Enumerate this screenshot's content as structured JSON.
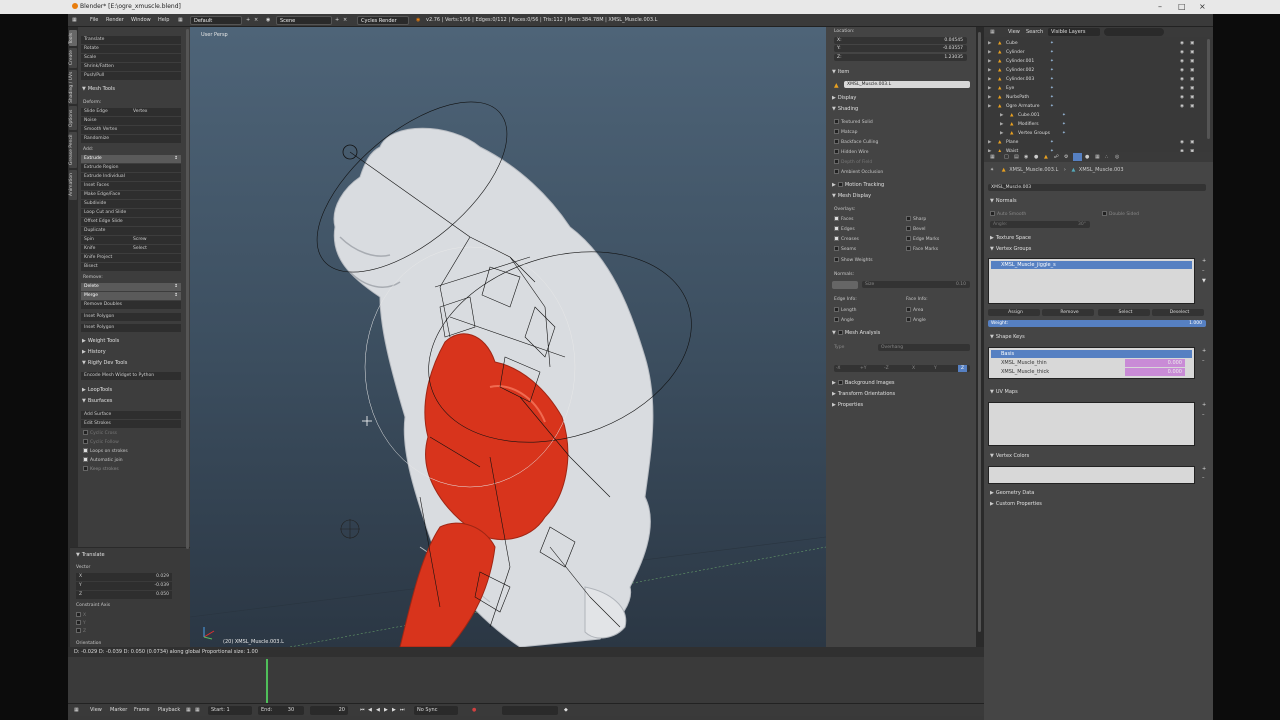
{
  "window_title": "Blender* [E:\\ogre_xmuscle.blend]",
  "info_header": {
    "menus": [
      "File",
      "Render",
      "Window",
      "Help"
    ],
    "layout": "Default",
    "scene": "Scene",
    "engine": "Cycles Render",
    "stats": "v2.76 | Verts:1/56 | Edges:0/112 | Faces:0/56 | Tris:112 | Mem:384.78M | XMSL_Muscle.003.L"
  },
  "vertical_tabs": [
    "Tools",
    "Create",
    "Shading / UVs",
    "Options",
    "Grease Pencil",
    "Animation"
  ],
  "tool_shelf": {
    "transform_buttons": [
      "Translate",
      "Rotate",
      "Scale",
      "Shrink/Fatten",
      "Push/Pull"
    ],
    "mesh_tools_header": "Mesh Tools",
    "deform_label": "Deform:",
    "deform_buttons": [
      {
        "left": "Slide Edge",
        "right": "Vertex"
      },
      {
        "left": "Noise",
        "right": ""
      },
      {
        "left": "Smooth Vertex",
        "right": ""
      },
      {
        "left": "Randomize",
        "right": ""
      }
    ],
    "add_label": "Add:",
    "add_buttons": [
      "Extrude",
      "Extrude Region",
      "Extrude Individual",
      "Inset Faces",
      "Make Edge/Face",
      "Subdivide",
      "Loop Cut and Slide",
      "Offset Edge Slide",
      "Duplicate"
    ],
    "pair_buttons": [
      {
        "left": "Spin",
        "right": "Screw"
      },
      {
        "left": "Knife",
        "right": "Select"
      }
    ],
    "extra_buttons": [
      "Knife Project",
      "Bisect"
    ],
    "remove_label": "Remove:",
    "remove_buttons": [
      "Delete",
      "Merge",
      "Remove Doubles"
    ],
    "inset_buttons": [
      "Inset Polygon",
      "Inset Polygon"
    ],
    "panels": [
      "Weight Tools",
      "History",
      "Rigify Dev Tools"
    ],
    "encode_button": "Encode Mesh Widget to Python",
    "looptools": "LoopTools",
    "bsurfaces": "Bsurfaces",
    "bsurf_buttons": [
      "Add Surface",
      "Edit Strokes"
    ],
    "bsurf_disabled": [
      "Cyclic Cross",
      "Cyclic Follow"
    ],
    "bsurf_checks": [
      "Loops on strokes",
      "Automatic join"
    ],
    "bsurf_last": "Keep strokes",
    "operator_panel": {
      "title": "Translate",
      "vector_label": "Vector",
      "vector": [
        {
          "axis": "X",
          "value": "0.029"
        },
        {
          "axis": "Y",
          "value": "-0.039"
        },
        {
          "axis": "Z",
          "value": "0.050"
        }
      ],
      "constraint_label": "Constraint Axis",
      "constraint_axes": [
        "X",
        "Y",
        "Z"
      ],
      "orientation_label": "Orientation"
    }
  },
  "viewport": {
    "view_label": "User Persp",
    "object_label": "(20) XMSL_Muscle.003.L",
    "status": "D: -0.029  D: -0.039  D: 0.050 (0.0734) along global   Proportional size: 1.00"
  },
  "n_panel": {
    "location_label": "Location:",
    "location": [
      {
        "axis": "X:",
        "value": "0.04545"
      },
      {
        "axis": "Y:",
        "value": "-0.03557"
      },
      {
        "axis": "Z:",
        "value": "1.23035"
      }
    ],
    "item_header": "Item",
    "item_name": "XMSL_Muscle.003.L",
    "display_header": "Display",
    "shading_header": "Shading",
    "shading_options": [
      "Textured Solid",
      "Matcap",
      "Backface Culling",
      "Hidden Wire",
      "Depth of Field",
      "Ambient Occlusion"
    ],
    "motion_tracking": "Motion Tracking",
    "mesh_display_header": "Mesh Display",
    "overlays_label": "Overlays:",
    "overlays_left": [
      "Faces",
      "Edges",
      "Creases",
      "Seams",
      "Show Weights"
    ],
    "overlays_right": [
      "Sharp",
      "Bevel",
      "Edge Marks",
      "Face Marks"
    ],
    "normals_label": "Normals:",
    "normals_size_label": "Size",
    "normals_size": "0.10",
    "edge_info_label": "Edge Info:",
    "edge_info": [
      "Length",
      "Angle"
    ],
    "face_info_label": "Face Info:",
    "face_info": [
      "Area",
      "Angle"
    ],
    "mesh_analysis": "Mesh Analysis",
    "type_label": "Type",
    "type_value": "Overhang",
    "axis_buttons": [
      "-X",
      "+Y",
      "-Z",
      "X",
      "Y",
      "Z"
    ],
    "collapsed_panels": [
      "Background Images",
      "Transform Orientations",
      "Properties"
    ]
  },
  "outliner": {
    "header": {
      "view": "View",
      "search": "Search",
      "layers": "Visible Layers"
    },
    "rows": [
      "Cube",
      "Cylinder",
      "Cylinder.001",
      "Cylinder.002",
      "Cylinder.003",
      "Eye",
      "NurbsPath",
      "Ogre Armature",
      "Cube.001",
      "Modifiers",
      "Vertex Groups",
      "Plane",
      "Waist"
    ]
  },
  "properties": {
    "breadcrumb": [
      "XMSL_Muscle.003.L",
      "XMSL_Muscle.003"
    ],
    "mesh_name": "XMSL_Muscle.003",
    "normals_header": "Normals",
    "auto_smooth": "Auto Smooth",
    "double_sided": "Double Sided",
    "angle_label": "Angle:",
    "angle_value": "30°",
    "texture_space": "Texture Space",
    "vertex_groups": "Vertex Groups",
    "vgroup_item": "XMSL_Muscle_jiggle_s",
    "vg_buttons": [
      "Assign",
      "Remove",
      "Select",
      "Deselect"
    ],
    "weight_label": "Weight:",
    "weight_value": "1.000",
    "shape_keys": "Shape Keys",
    "shape_items": [
      {
        "name": "Basis",
        "value": ""
      },
      {
        "name": "XMSL_Muscle_thin",
        "value": "0.000"
      },
      {
        "name": "XMSL_Muscle_thick",
        "value": "0.000"
      }
    ],
    "uv_maps": "UV Maps",
    "vertex_colors": "Vertex Colors",
    "geometry_data": "Geometry Data",
    "custom_properties": "Custom Properties"
  },
  "timeline": {
    "menus": [
      "View",
      "Marker",
      "Frame",
      "Playback"
    ],
    "start_label": "Start:",
    "start": "1",
    "end_label": "End:",
    "end": "30",
    "current": "20",
    "sync": "No Sync"
  },
  "colors": {
    "muscle": "#d8341c",
    "body": "#d9dce0",
    "selection": "#5680c2",
    "timeline_cursor": "#4fbf5a"
  }
}
